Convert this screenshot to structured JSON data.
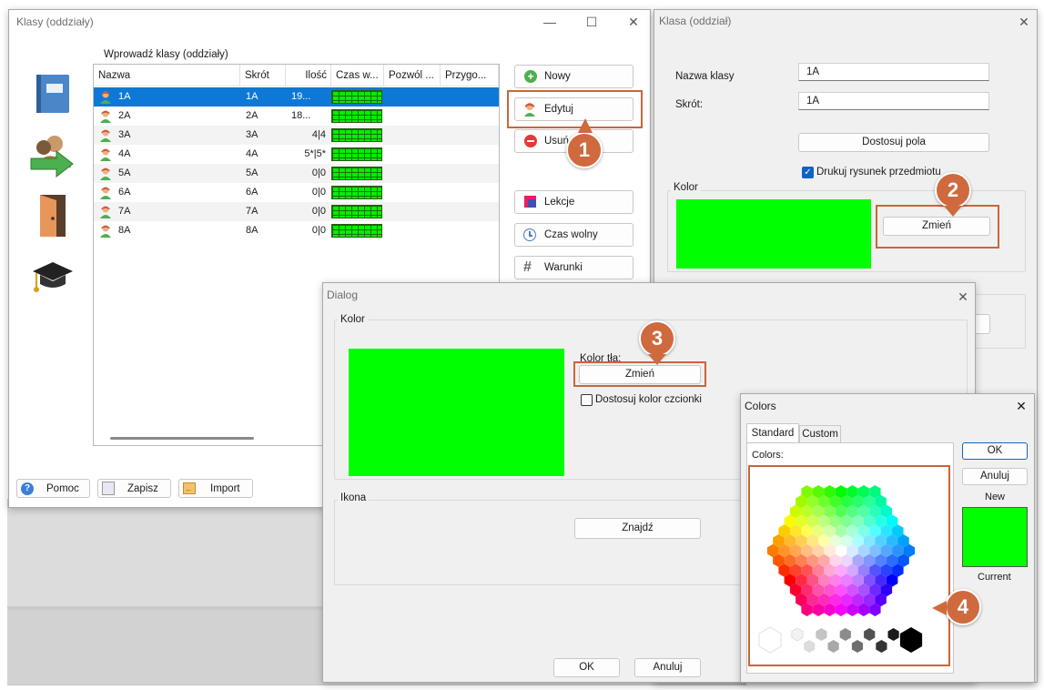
{
  "klasy_window": {
    "title": "Klasy (oddziały)",
    "list_label": "Wprowadź klasy (oddziały)",
    "columns": [
      "Nazwa",
      "Skrót",
      "Ilość",
      "Czas w...",
      "Pozwól ...",
      "Przygo..."
    ],
    "rows": [
      {
        "name": "1A",
        "short": "1A",
        "count": "19..."
      },
      {
        "name": "2A",
        "short": "2A",
        "count": "18..."
      },
      {
        "name": "3A",
        "short": "3A",
        "count": "4|4"
      },
      {
        "name": "4A",
        "short": "4A",
        "count": "5*|5*"
      },
      {
        "name": "5A",
        "short": "5A",
        "count": "0|0"
      },
      {
        "name": "6A",
        "short": "6A",
        "count": "0|0"
      },
      {
        "name": "7A",
        "short": "7A",
        "count": "0|0"
      },
      {
        "name": "8A",
        "short": "8A",
        "count": "0|0"
      }
    ],
    "buttons": {
      "nowy": "Nowy",
      "edytuj": "Edytuj",
      "usun": "Usuń",
      "lekcje": "Lekcje",
      "czas_wolny": "Czas wolny",
      "warunki": "Warunki",
      "pomoc": "Pomoc",
      "zapisz": "Zapisz",
      "import": "Import"
    }
  },
  "klasa_window": {
    "title": "Klasa (oddział)",
    "nazwa_label": "Nazwa klasy",
    "nazwa_value": "1A",
    "skrot_label": "Skrót:",
    "skrot_value": "1A",
    "dostosuj_pola": "Dostosuj pola",
    "drukuj_label": "Drukuj rysunek przedmiotu",
    "kolor_group": "Kolor",
    "zmien": "Zmień"
  },
  "dialog_window": {
    "title": "Dialog",
    "kolor_group": "Kolor",
    "kolor_tla": "Kolor tła:",
    "zmien": "Zmień",
    "dostosuj_czcionki": "Dostosuj kolor czcionki",
    "ikona_group": "Ikona",
    "znajdz": "Znajdź",
    "ok": "OK",
    "anuluj": "Anuluj"
  },
  "colors_window": {
    "title": "Colors",
    "tab_standard": "Standard",
    "tab_custom": "Custom",
    "colors_label": "Colors:",
    "ok": "OK",
    "anuluj": "Anuluj",
    "new_label": "New",
    "current_label": "Current"
  },
  "callouts": [
    "1",
    "2",
    "3",
    "4"
  ],
  "colors": {
    "accent_orange": "#c8663a",
    "selected_color": "#00ff00",
    "selection_blue": "#0e78d7"
  }
}
